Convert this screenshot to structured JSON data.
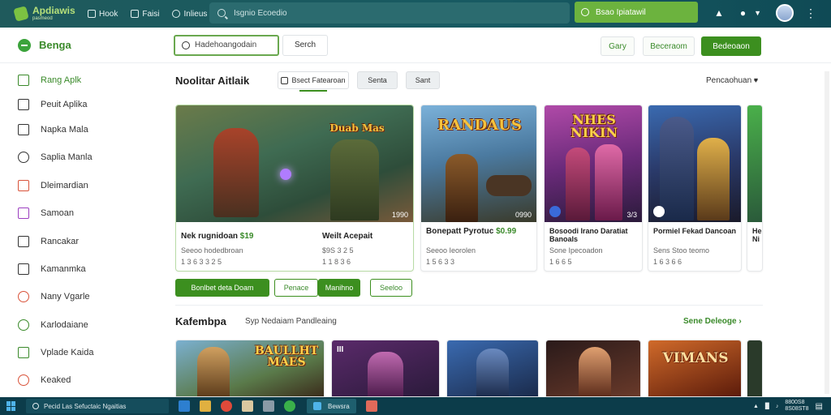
{
  "topbar": {
    "logo_text": "Apdiawis",
    "logo_sub": "pasmeod",
    "nav": [
      {
        "label": "Hook",
        "icon": "home-icon"
      },
      {
        "label": "Faisi",
        "icon": "grid-icon"
      },
      {
        "label": "Inlieus",
        "icon": "info-icon"
      }
    ],
    "search_placeholder": "Isgnio Ecoedio",
    "green_search_label": "Bsao Ipiatawil"
  },
  "apphead": {
    "brand": "Benga",
    "search_value": "Hadehoangodain",
    "search_button": "Serch",
    "btn1": "Gary",
    "btn2": "Beceraom",
    "btn3": "Bedeoaon"
  },
  "sidebar": {
    "items": [
      {
        "label": "Rang Aplk",
        "icon": "apps-icon",
        "active": true
      },
      {
        "label": "Peuit Aplika",
        "icon": "store-icon"
      },
      {
        "label": "Napka Mala",
        "icon": "grid-icon"
      },
      {
        "label": "Saplia Manla",
        "icon": "shield-icon"
      },
      {
        "label": "Dleimardian",
        "icon": "list-icon"
      },
      {
        "label": "Samoan",
        "icon": "media-icon"
      },
      {
        "label": "Rancakar",
        "icon": "mail-icon"
      },
      {
        "label": "Kamanmka",
        "icon": "calendar-icon"
      },
      {
        "label": "Nany Vgarle",
        "icon": "globe-icon"
      },
      {
        "label": "Karlodaiane",
        "icon": "circle-icon"
      },
      {
        "label": "Vplade Kaida",
        "icon": "plus-icon"
      },
      {
        "label": "Keaked",
        "icon": "game-icon"
      }
    ]
  },
  "main": {
    "section_title": "Noolitar Aitlaik",
    "chips": [
      "Bsect Fatearoan",
      "Senta",
      "Sant"
    ],
    "sort_label": "Pencaohuan",
    "featured": [
      {
        "name": "Nek rugnidoan",
        "price": "$19",
        "meta": "Seeoo hodedbroan",
        "meta2": "1 3 6 3 3 2 5",
        "art_title": "Duab Mas",
        "corner": "1990",
        "right_name": "Weilt Acepait",
        "right_meta": "$9S 3 2 5",
        "right_meta2": "1 1 8 3 6"
      },
      {
        "name": "Bonepatt Pyrotuc",
        "price": "$0.99",
        "meta": "Seeoo Ieorolen",
        "meta2": "1 5 6 3 3",
        "art_title": "RANDAUS",
        "corner": "0990"
      },
      {
        "name": "Bosoodi Irano Daratiat Banoals",
        "price": "",
        "meta": "Sone Ipecoadon",
        "meta2": "1 6 6 5",
        "art_title": "NHES NIKIN",
        "corner": "3/3"
      },
      {
        "name": "Pormiel Fekad Dancoan",
        "price": "",
        "meta": "Sens Stoo teomo",
        "meta2": "1 6 3 6 6",
        "art_title": "",
        "corner": ""
      },
      {
        "name": "He Ni",
        "price": "",
        "meta": "",
        "meta2": "",
        "art_title": "",
        "corner": ""
      }
    ],
    "actions": [
      "Bonlbet deta Doam",
      "Penace",
      "Manihno",
      "Seeloo"
    ],
    "category_title": "Kafembpa",
    "category_sub": "Syp Nedaiam Pandleaing",
    "see_more": "Sene Deleoge"
  },
  "bottom_cards": [
    {
      "title": "BAULLHT MAES",
      "icon": "game-tile"
    },
    {
      "title": "III",
      "icon": "game-tile"
    },
    {
      "title": "",
      "icon": "game-tile"
    },
    {
      "title": "",
      "icon": "game-tile"
    },
    {
      "title": "VIMANS",
      "icon": "game-tile"
    }
  ],
  "taskbar": {
    "search_text": "Pecid Las Sefuctaic Ngaitias",
    "app_label": "Bewsra",
    "clock_line1": "8800S8",
    "clock_line2": "8S08ST8"
  }
}
